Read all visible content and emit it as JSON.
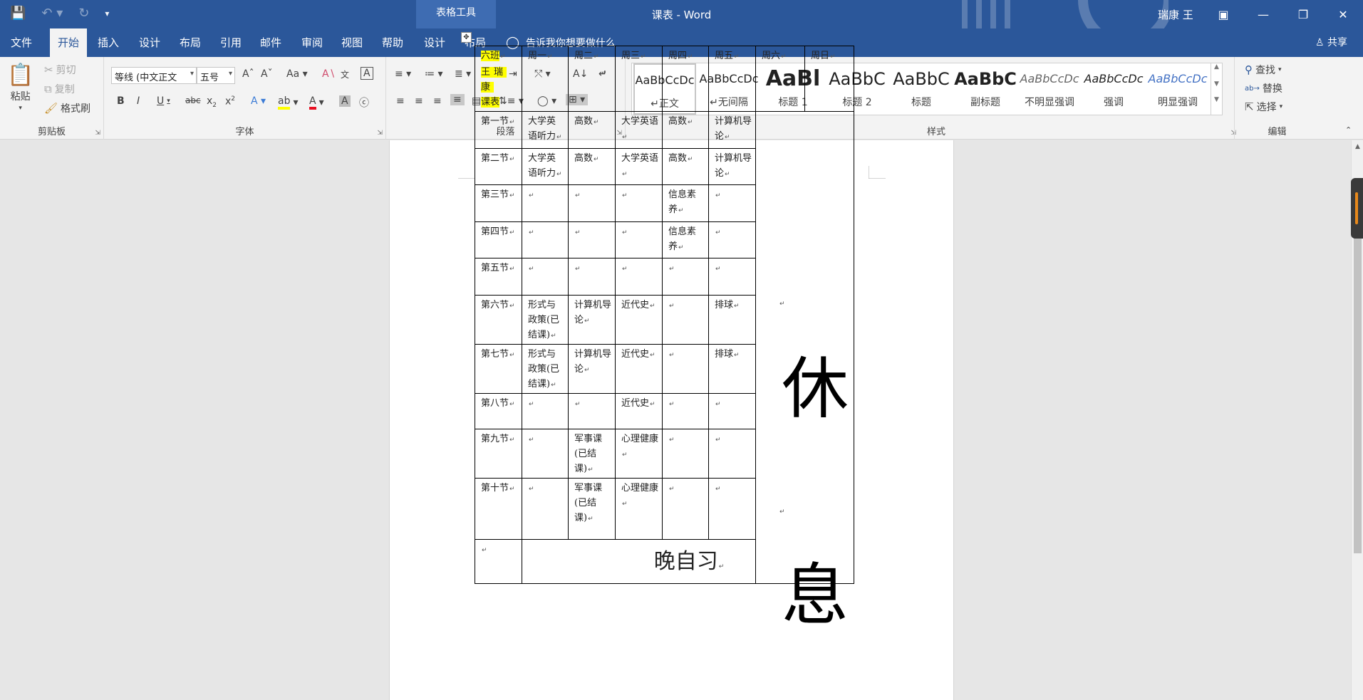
{
  "titlebar": {
    "context_tab": "表格工具",
    "doc_title": "课表 - Word",
    "user": "瑞康 王",
    "qat_icons": [
      "save-icon",
      "undo-icon",
      "redo-icon",
      "customize-icon"
    ],
    "window_buttons": [
      "ribbon-options-icon",
      "minimize-icon",
      "restore-icon",
      "close-icon"
    ]
  },
  "tabs": [
    {
      "label": "文件"
    },
    {
      "label": "开始"
    },
    {
      "label": "插入"
    },
    {
      "label": "设计"
    },
    {
      "label": "布局"
    },
    {
      "label": "引用"
    },
    {
      "label": "邮件"
    },
    {
      "label": "审阅"
    },
    {
      "label": "视图"
    },
    {
      "label": "帮助"
    },
    {
      "label": "设计"
    },
    {
      "label": "布局"
    }
  ],
  "tell_me": "告诉我你想要做什么",
  "share": "共享",
  "clipboard": {
    "label": "剪贴板",
    "paste": "粘贴",
    "cut": "剪切",
    "copy": "复制",
    "format_painter": "格式刷"
  },
  "font": {
    "label": "字体",
    "font_name": "等线 (中文正文",
    "font_size": "五号"
  },
  "paragraph": {
    "label": "段落"
  },
  "styles": {
    "label": "样式",
    "items": [
      {
        "preview": "AaBbCcDc",
        "name": "正文"
      },
      {
        "preview": "AaBbCcDc",
        "name": "无间隔"
      },
      {
        "preview": "AaBl",
        "name": "标题 1"
      },
      {
        "preview": "AaBbC",
        "name": "标题 2"
      },
      {
        "preview": "AaBbC",
        "name": "标题"
      },
      {
        "preview": "AaBbC",
        "name": "副标题"
      },
      {
        "preview": "AaBbCcDc",
        "name": "不明显强调"
      },
      {
        "preview": "AaBbCcDc",
        "name": "强调"
      },
      {
        "preview": "AaBbCcDc",
        "name": "明显强调"
      }
    ]
  },
  "editing": {
    "label": "编辑",
    "find": "查找",
    "replace": "替换",
    "select": "选择"
  },
  "schedule": {
    "corner": [
      "六班",
      "王瑞康",
      "课表"
    ],
    "days": [
      "周一",
      "周二",
      "周三",
      "周四",
      "周五",
      "周六",
      "周日"
    ],
    "rows": [
      {
        "period": "第一节",
        "cells": [
          "大学英语听力",
          "高数",
          "大学英语",
          "高数",
          "计算机导论"
        ]
      },
      {
        "period": "第二节",
        "cells": [
          "大学英语听力",
          "高数",
          "大学英语",
          "高数",
          "计算机导论"
        ]
      },
      {
        "period": "第三节",
        "cells": [
          "",
          "",
          "",
          "信息素养",
          ""
        ]
      },
      {
        "period": "第四节",
        "cells": [
          "",
          "",
          "",
          "信息素养",
          ""
        ]
      },
      {
        "period": "第五节",
        "cells": [
          "",
          "",
          "",
          "",
          ""
        ]
      },
      {
        "period": "第六节",
        "cells": [
          "形式与政策(已结课)",
          "计算机导论",
          "近代史",
          "",
          "排球"
        ]
      },
      {
        "period": "第七节",
        "cells": [
          "形式与政策(已结课)",
          "计算机导论",
          "近代史",
          "",
          "排球"
        ]
      },
      {
        "period": "第八节",
        "cells": [
          "",
          "",
          "近代史",
          "",
          ""
        ]
      },
      {
        "period": "第九节",
        "cells": [
          "",
          "军事课(已结课)",
          "心理健康",
          "",
          ""
        ]
      },
      {
        "period": "第十节",
        "cells": [
          "",
          "军事课(已结课)",
          "心理健康",
          "",
          ""
        ]
      }
    ],
    "rest_top": "休",
    "rest_bottom": "息",
    "evening": "晚自习"
  }
}
